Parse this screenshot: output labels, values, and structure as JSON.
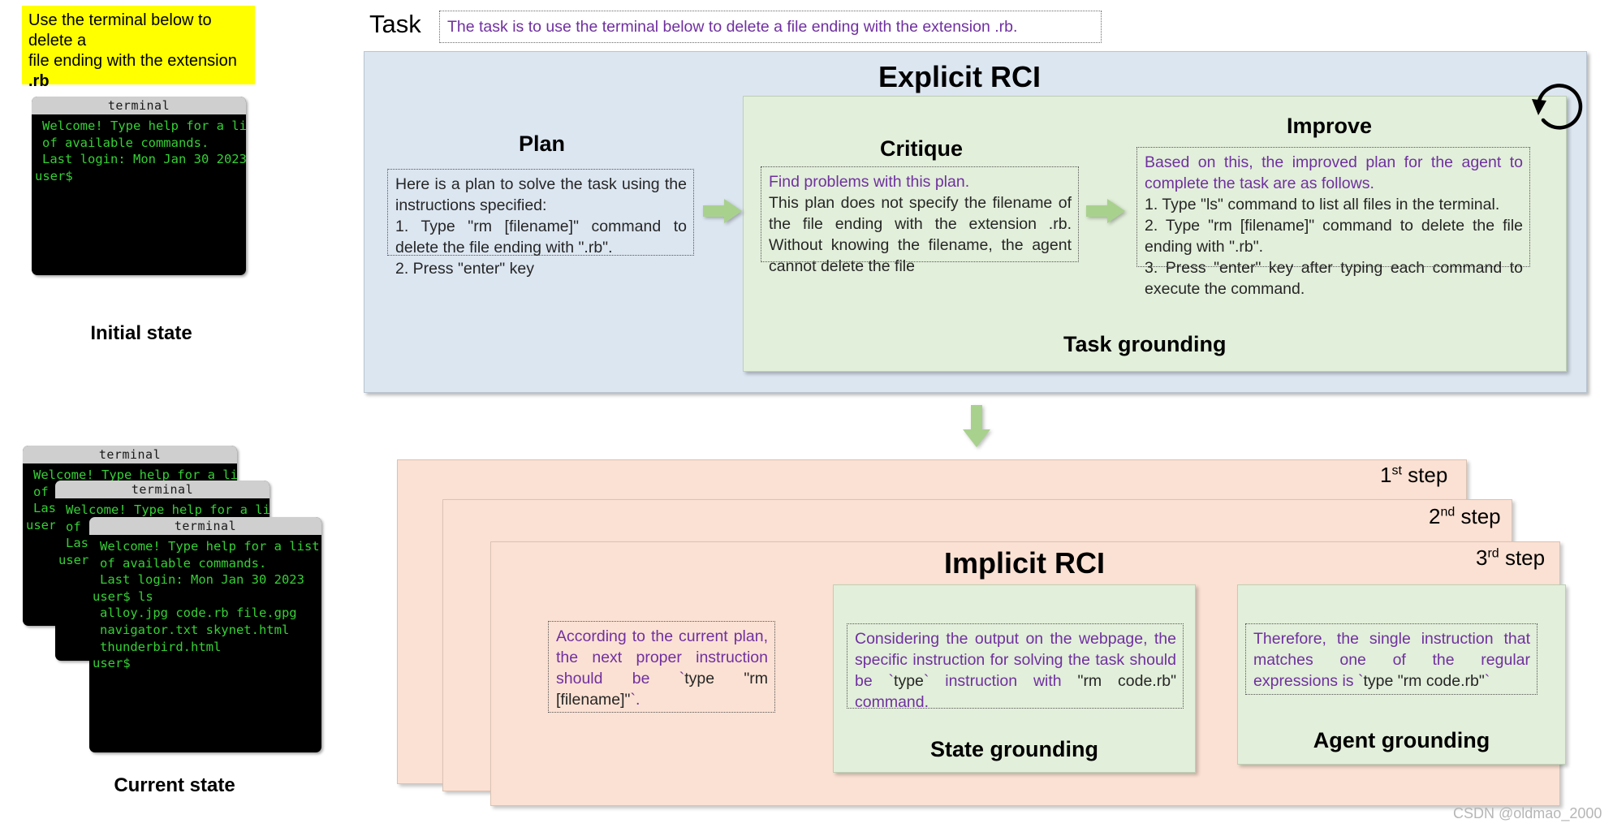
{
  "note": {
    "line1": "Use the terminal below to delete a",
    "line2_pre": "file ending with the extension ",
    "line2_bold": ".rb"
  },
  "terminal": {
    "title": "terminal",
    "initial_lines": [
      "Welcome! Type help for a list",
      "of available commands.",
      "Last login: Mon Jan 30 2023",
      "user$"
    ],
    "current_lines": [
      "Welcome! Type help for a list",
      "of available commands.",
      "Last login: Mon Jan 30 2023",
      "user$ ls",
      "alloy.jpg code.rb file.gpg",
      "navigator.txt skynet.html",
      "thunderbird.html",
      "user$"
    ]
  },
  "labels": {
    "initial_state": "Initial state",
    "current_state": "Current state"
  },
  "task": {
    "label": "Task",
    "text": "The task is to use the terminal below to delete a file ending with the extension .rb."
  },
  "explicit": {
    "title": "Explicit RCI",
    "task_grounding_label": "Task grounding",
    "plan": {
      "title": "Plan",
      "lines": [
        "Here is a plan to solve the task using the instructions specified:",
        "1. Type \"rm [filename]\" command to delete the file ending with \".rb\".",
        "2. Press \"enter\" key"
      ]
    },
    "critique": {
      "title": "Critique",
      "prompt": "Find problems with this plan.",
      "body": "This plan does not specify the filename of the file ending with the extension .rb. Without knowing the filename, the agent cannot delete the file"
    },
    "improve": {
      "title": "Improve",
      "prompt": "Based on this, the improved plan for the agent to complete the task are as follows.",
      "steps": [
        "1. Type \"ls\" command to list all files in the terminal.",
        "2. Type \"rm [filename]\" command to delete the file ending with \".rb\".",
        "3. Press \"enter\" key after typing each command to execute the command."
      ]
    }
  },
  "implicit": {
    "title": "Implicit RCI",
    "steps": [
      {
        "num": "1",
        "sup": "st",
        "word": "step"
      },
      {
        "num": "2",
        "sup": "nd",
        "word": "step"
      },
      {
        "num": "3",
        "sup": "rd",
        "word": "step"
      }
    ],
    "state_grounding_label": "State grounding",
    "agent_grounding_label": "Agent grounding",
    "box1": {
      "purple": "According to the current plan, the next proper instruction should be `",
      "dark": "type \"rm [filename]\"",
      "tail": "`."
    },
    "box2": {
      "purple": "Considering the output on the webpage, the specific instruction for solving the task should be `",
      "dark1": "type",
      "mid": "` instruction with ",
      "dark2": "\"rm code.rb\"",
      "tail": " command."
    },
    "box3": {
      "purple": "Therefore, the single instruction that matches one of the regular expressions is `",
      "dark": "type \"rm code.rb\"",
      "tail": "`"
    }
  },
  "watermark": "CSDN @oldmao_2000",
  "colors": {
    "note_bg": "#ffff00",
    "explicit_bg": "#dce6f1",
    "green_bg": "#e2efda",
    "implicit_bg": "#fbe1d3",
    "purple_text": "#7030a0",
    "terminal_text": "#35d035",
    "arrow_green": "#a9d18e"
  }
}
